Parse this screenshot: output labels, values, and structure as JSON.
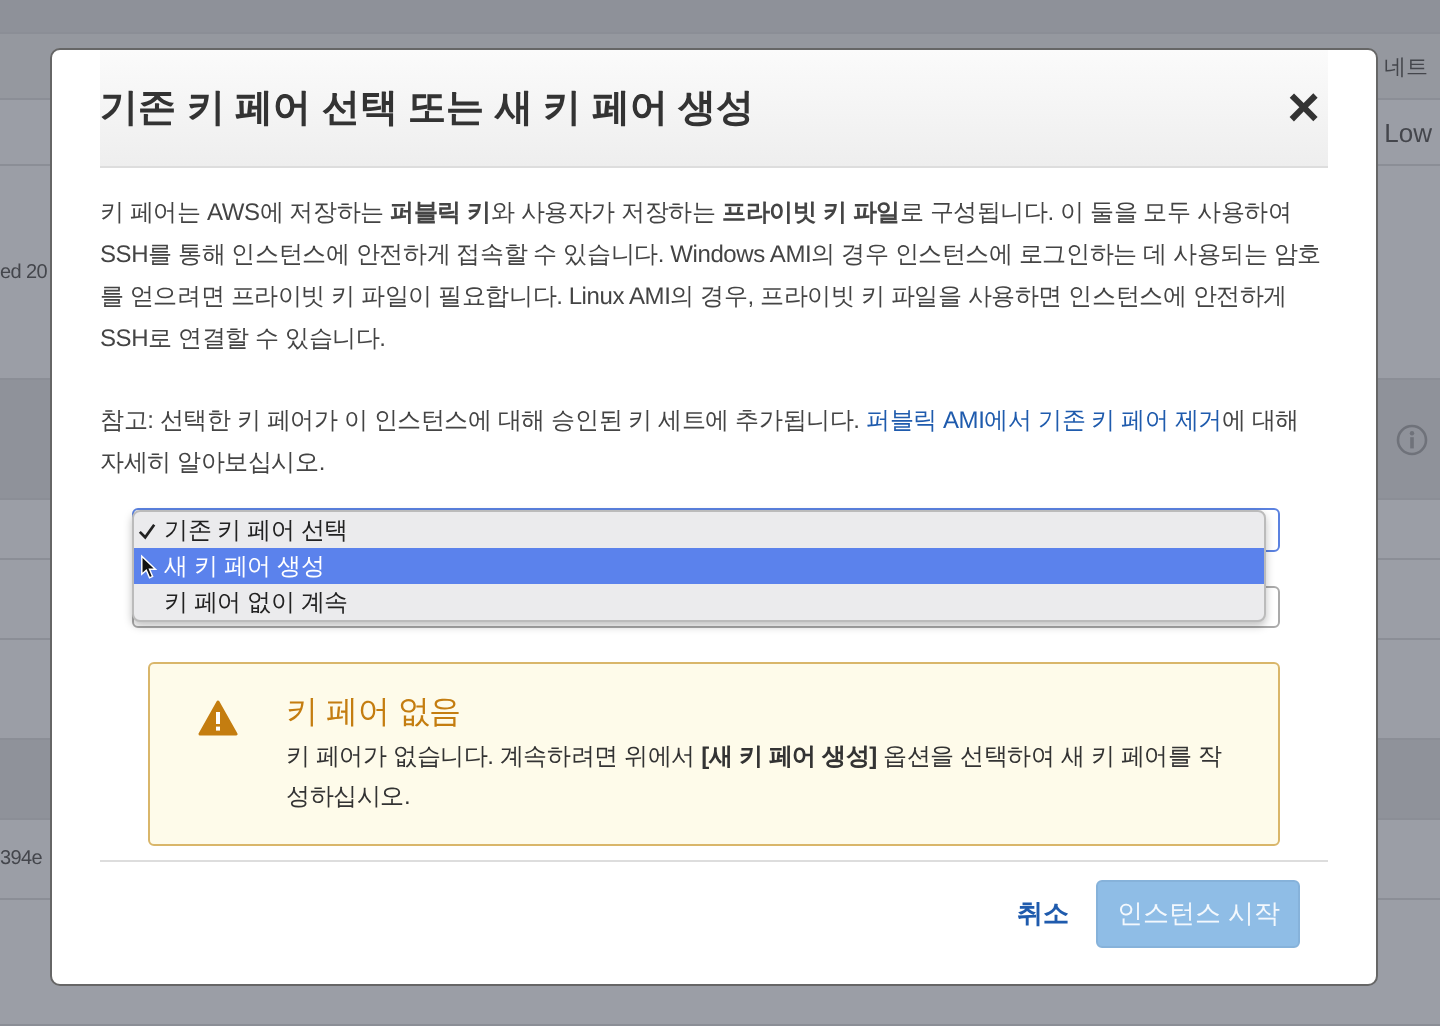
{
  "background": {
    "texts": [
      {
        "kind": "header",
        "text": "네트"
      },
      {
        "kind": "cell",
        "text": "Low"
      },
      {
        "kind": "cell",
        "text": "ed 20"
      },
      {
        "kind": "cell",
        "text": "394e"
      }
    ]
  },
  "dialog": {
    "title": "기존 키 페어 선택 또는 새 키 페어 생성",
    "close": "×",
    "intro": "키 페어는 AWS에 저장하는 **퍼블릭 키**와 사용자가 저장하는 **프라이빗 키 파일**로 구성됩니다. 이 둘을 모두 사용하여 SSH를 통해 인스턴스에 안전하게 접속할 수 있습니다. Windows AMI의 경우 인스턴스에 로그인하는 데 사용되는 암호를 얻으려면 프라이빗 키 파일이 필요합니다. Linux AMI의 경우, 프라이빗 키 파일을 사용하면 인스턴스에 안전하게 SSH로 연결할 수 있습니다.",
    "note": {
      "before": "참고: 선택한 키 페어가 이 인스턴스에 대해 승인된 키 세트에 추가됩니다. ",
      "link": "퍼블릭 AMI에서 기존 키 페어 제거",
      "after": "에 대해 자세히 알아보십시오."
    },
    "select_options": [
      {
        "label": "기존 키 페어 선택",
        "checked": true,
        "selected": false
      },
      {
        "label": "새 키 페어 생성",
        "checked": false,
        "selected": true
      },
      {
        "label": "키 페어 없이 계속",
        "checked": false,
        "selected": false
      }
    ],
    "warning": {
      "title": "키 페어 없음",
      "message": "키 페어가 없습니다. 계속하려면 위에서 **[새 키 페어 생성]** 옵션을 선택하여 새 키 페어를 작성하십시오."
    },
    "buttons": [
      {
        "kind": "link",
        "label": "취소",
        "disabled": false
      },
      {
        "kind": "primary",
        "label": "인스턴스 시작",
        "disabled": true
      }
    ]
  }
}
